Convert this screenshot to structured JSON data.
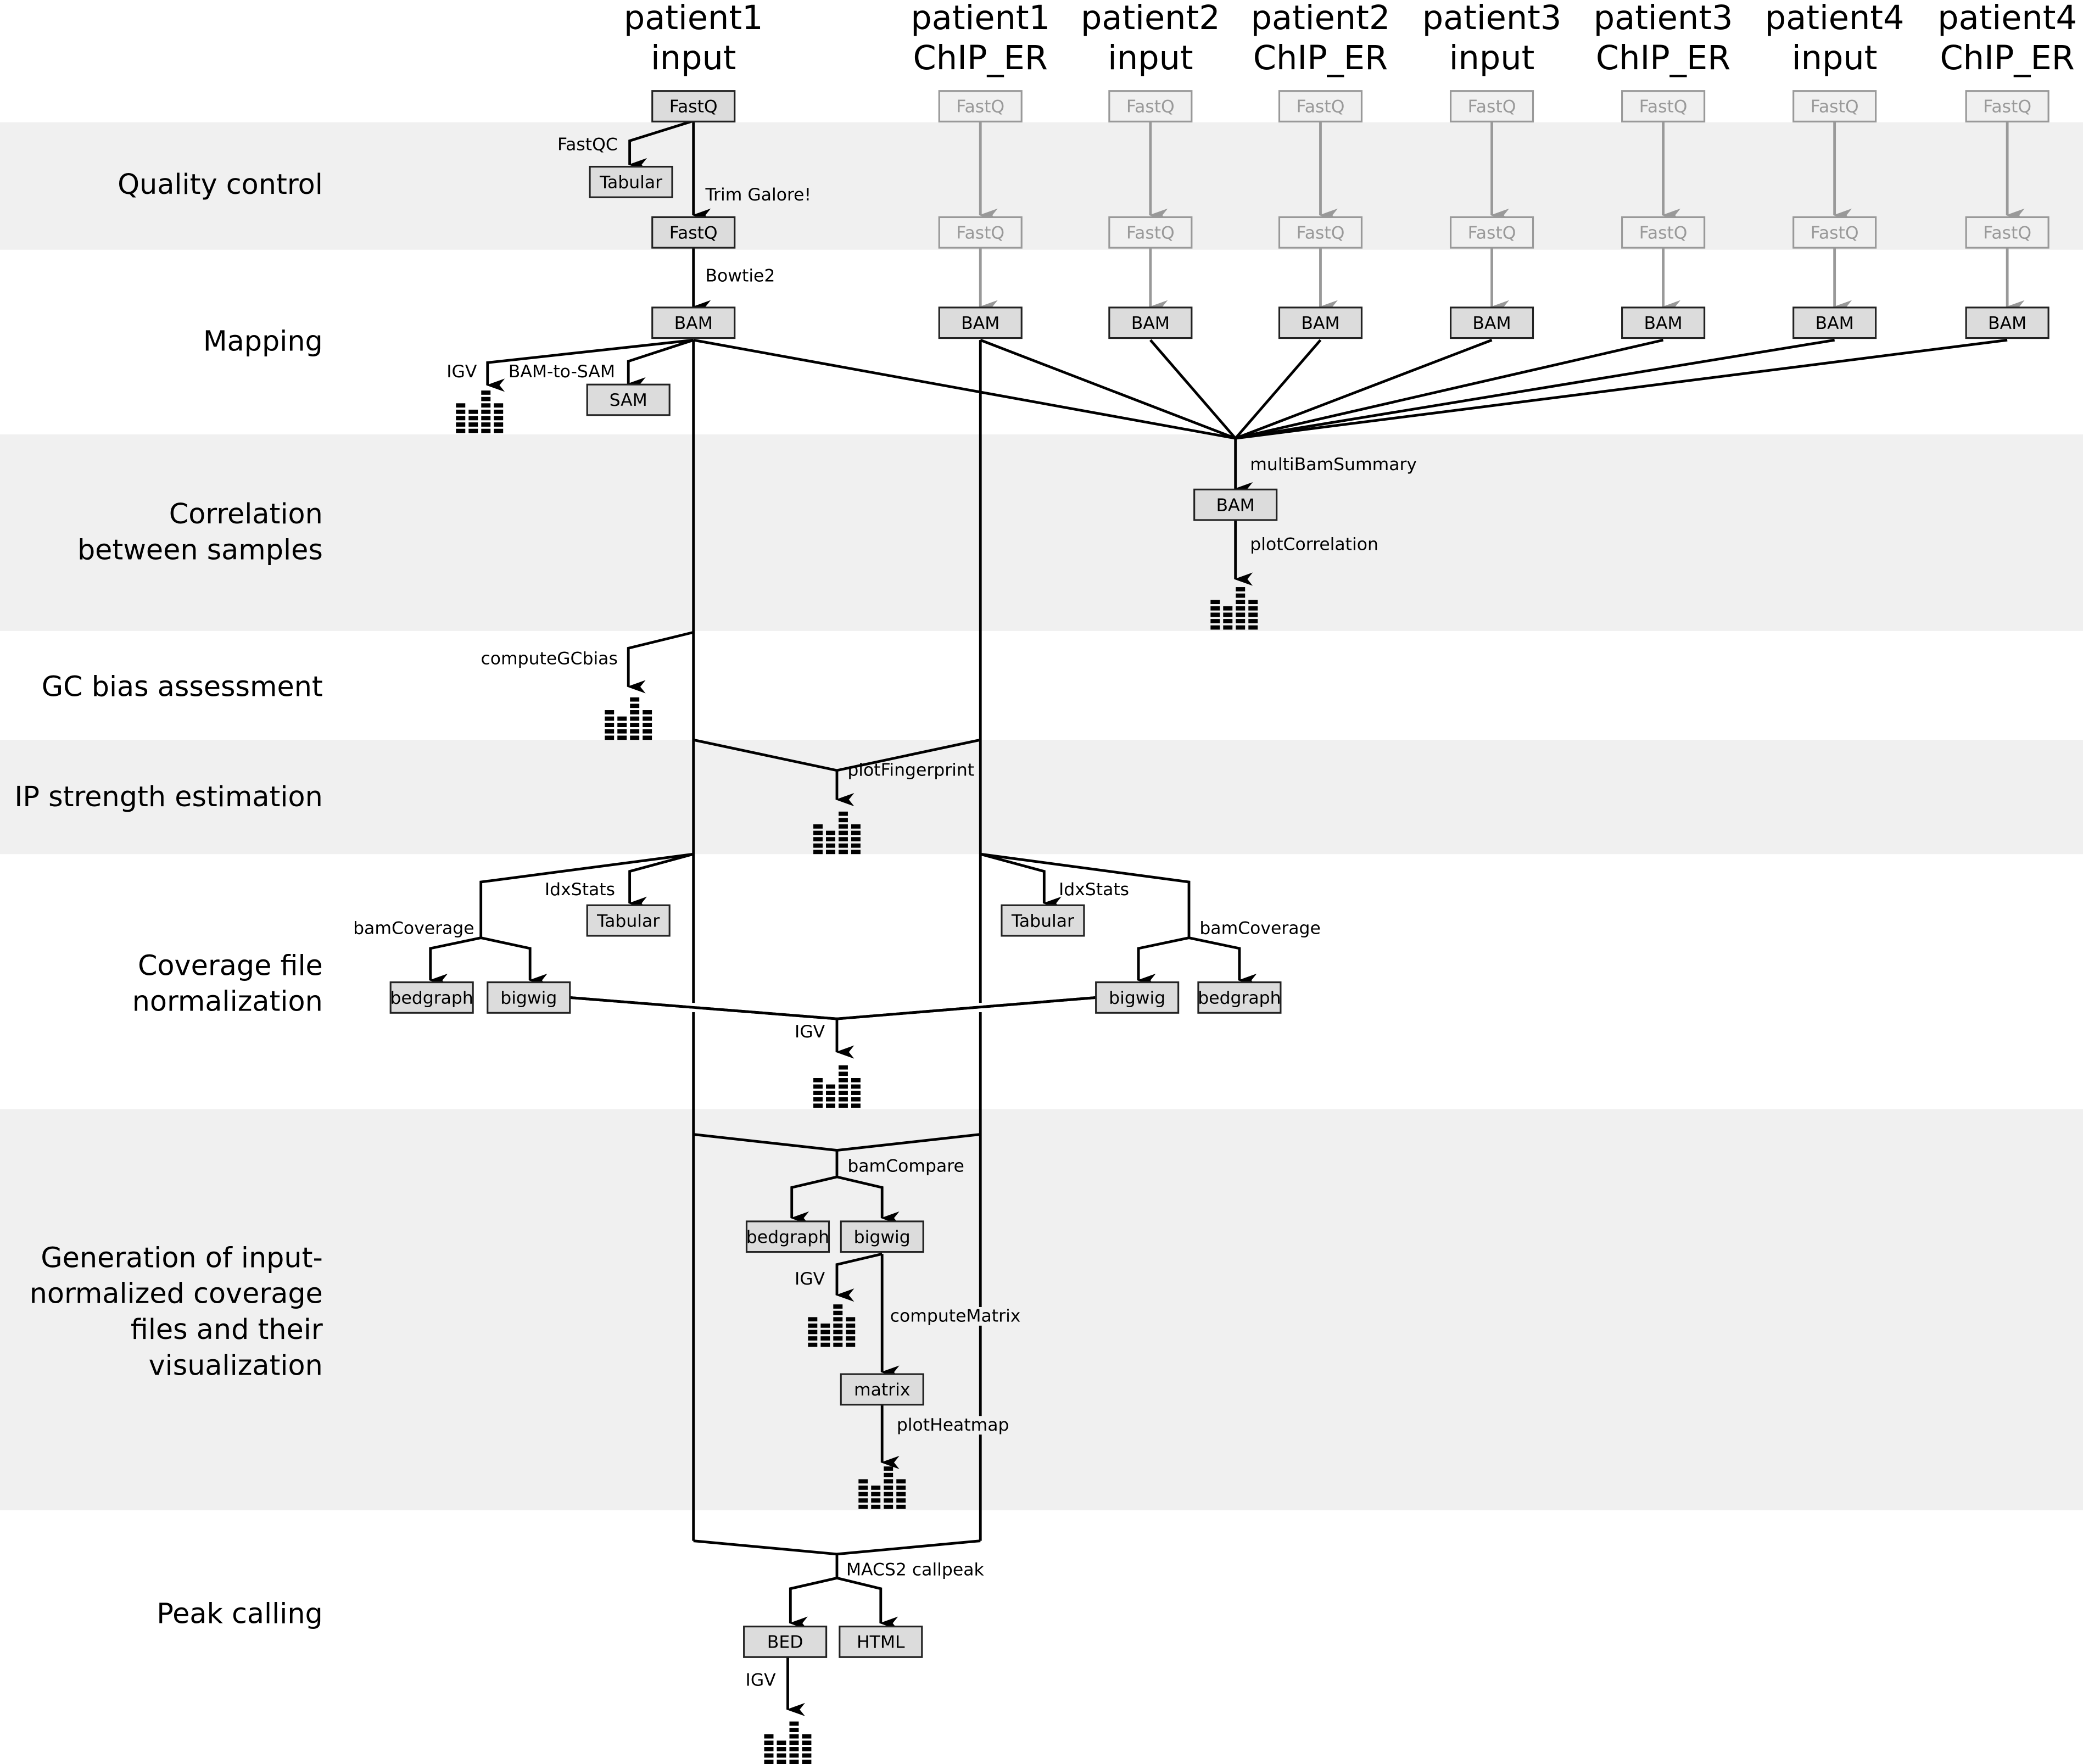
{
  "columns": [
    {
      "line1": "patient1",
      "line2": "input"
    },
    {
      "line1": "patient1",
      "line2": "ChIP_ER"
    },
    {
      "line1": "patient2",
      "line2": "input"
    },
    {
      "line1": "patient2",
      "line2": "ChIP_ER"
    },
    {
      "line1": "patient3",
      "line2": "input"
    },
    {
      "line1": "patient3",
      "line2": "ChIP_ER"
    },
    {
      "line1": "patient4",
      "line2": "input"
    },
    {
      "line1": "patient4",
      "line2": "ChIP_ER"
    }
  ],
  "stages": {
    "quality_control": [
      "Quality control"
    ],
    "mapping": [
      "Mapping"
    ],
    "correlation": [
      "Correlation",
      "between samples"
    ],
    "gc_bias": [
      "GC bias assessment"
    ],
    "ip_strength": [
      "IP strength estimation"
    ],
    "coverage": [
      "Coverage file",
      "normalization"
    ],
    "input_normalized": [
      "Generation of input-",
      "normalized coverage",
      "files and their",
      "visualization"
    ],
    "peak_calling": [
      "Peak calling"
    ]
  },
  "boxes": {
    "fastq": "FastQ",
    "tabular": "Tabular",
    "bam": "BAM",
    "sam": "SAM",
    "bedgraph": "bedgraph",
    "bigwig": "bigwig",
    "matrix": "matrix",
    "bed": "BED",
    "html": "HTML"
  },
  "tools": {
    "fastqc": "FastQC",
    "trim_galore": "Trim Galore!",
    "bowtie2": "Bowtie2",
    "igv": "IGV",
    "bam_to_sam": "BAM-to-SAM",
    "multibamsummary": "multiBamSummary",
    "plotcorrelation": "plotCorrelation",
    "computegcbias": "computeGCbias",
    "plotfingerprint": "plotFingerprint",
    "idxstats": "IdxStats",
    "bamcoverage": "bamCoverage",
    "bamcompare": "bamCompare",
    "computematrix": "computeMatrix",
    "plotheatmap": "plotHeatmap",
    "macs2_callpeak": "MACS2 callpeak"
  },
  "icons": {
    "plot_output": "bar-chart-icon"
  },
  "colors": {
    "band": "#f0f0f0",
    "box_fill": "#dcdcdc",
    "faded": "#999999"
  }
}
